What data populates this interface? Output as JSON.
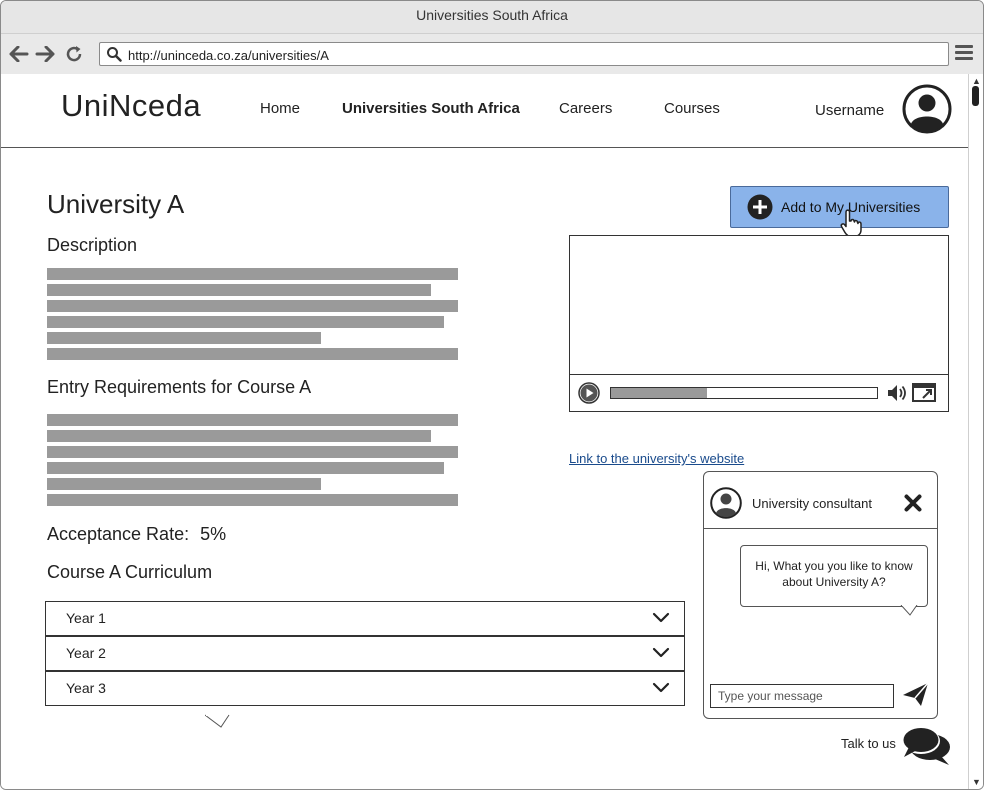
{
  "browser": {
    "window_title": "Universities South Africa",
    "url": "http://uninceda.co.za/universities/A"
  },
  "site": {
    "logo": "UniNceda",
    "nav": [
      {
        "label": "Home"
      },
      {
        "label": "Universities South Africa"
      },
      {
        "label": "Careers"
      },
      {
        "label": "Courses"
      }
    ],
    "username": "Username"
  },
  "main": {
    "title": "University A",
    "description_heading": "Description",
    "entry_heading": "Entry Requirements for Course A",
    "acceptance_label": "Acceptance Rate:",
    "acceptance_value": "5%",
    "curriculum_heading": "Course A Curriculum",
    "curriculum_years": [
      {
        "label": "Year 1"
      },
      {
        "label": "Year 2"
      },
      {
        "label": "Year 3"
      }
    ],
    "add_button": "Add to My Universities",
    "video_progress": 0.36,
    "website_link": "Link to the university's website"
  },
  "chat": {
    "agent_name": "University consultant",
    "message": "Hi, What you you like to know about University A?",
    "input_placeholder": "Type your message",
    "talk_label": "Talk to us"
  },
  "colors": {
    "accent_button": "#8ab3ea",
    "link": "#1a4b8c",
    "placeholder_bar": "#9a9a9a"
  }
}
